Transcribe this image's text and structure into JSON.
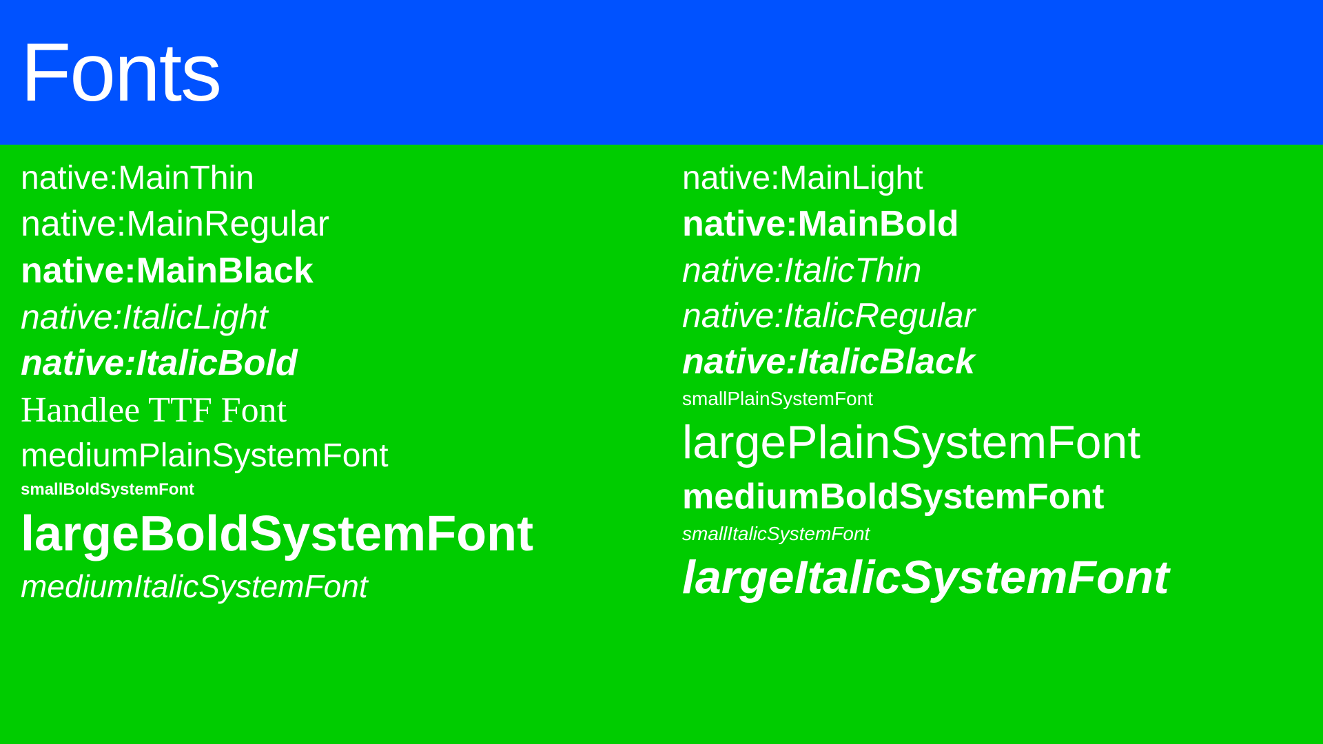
{
  "header": {
    "title": "Fonts",
    "background_color": "#0052FF"
  },
  "content": {
    "background_color": "#00CC00",
    "left_column": [
      {
        "label": "native:MainThin",
        "style": "thin"
      },
      {
        "label": "native:MainRegular",
        "style": "regular"
      },
      {
        "label": "native:MainBlack",
        "style": "black"
      },
      {
        "label": "native:ItalicLight",
        "style": "italic-light"
      },
      {
        "label": "native:ItalicBold",
        "style": "italic-bold"
      },
      {
        "label": "Handlee TTF Font",
        "style": "handlee"
      },
      {
        "label": "mediumPlainSystemFont",
        "style": "medium-plain"
      },
      {
        "label": "smallBoldSystemFont",
        "style": "small-bold"
      },
      {
        "label": "largeBoldSystemFont",
        "style": "large-bold"
      },
      {
        "label": "mediumItalicSystemFont",
        "style": "medium-italic"
      }
    ],
    "right_column": [
      {
        "label": "native:MainLight",
        "style": "light"
      },
      {
        "label": "native:MainBold",
        "style": "main-bold"
      },
      {
        "label": "native:ItalicThin",
        "style": "italic-thin"
      },
      {
        "label": "native:ItalicRegular",
        "style": "italic-regular"
      },
      {
        "label": "native:ItalicBlack",
        "style": "italic-black"
      },
      {
        "label": "smallPlainSystemFont",
        "style": "small-plain"
      },
      {
        "label": "largePlainSystemFont",
        "style": "large-plain"
      },
      {
        "label": "mediumBoldSystemFont",
        "style": "medium-bold"
      },
      {
        "label": "smallItalicSystemFont",
        "style": "small-italic"
      },
      {
        "label": "largeItalicSystemFont",
        "style": "large-italic"
      }
    ]
  }
}
